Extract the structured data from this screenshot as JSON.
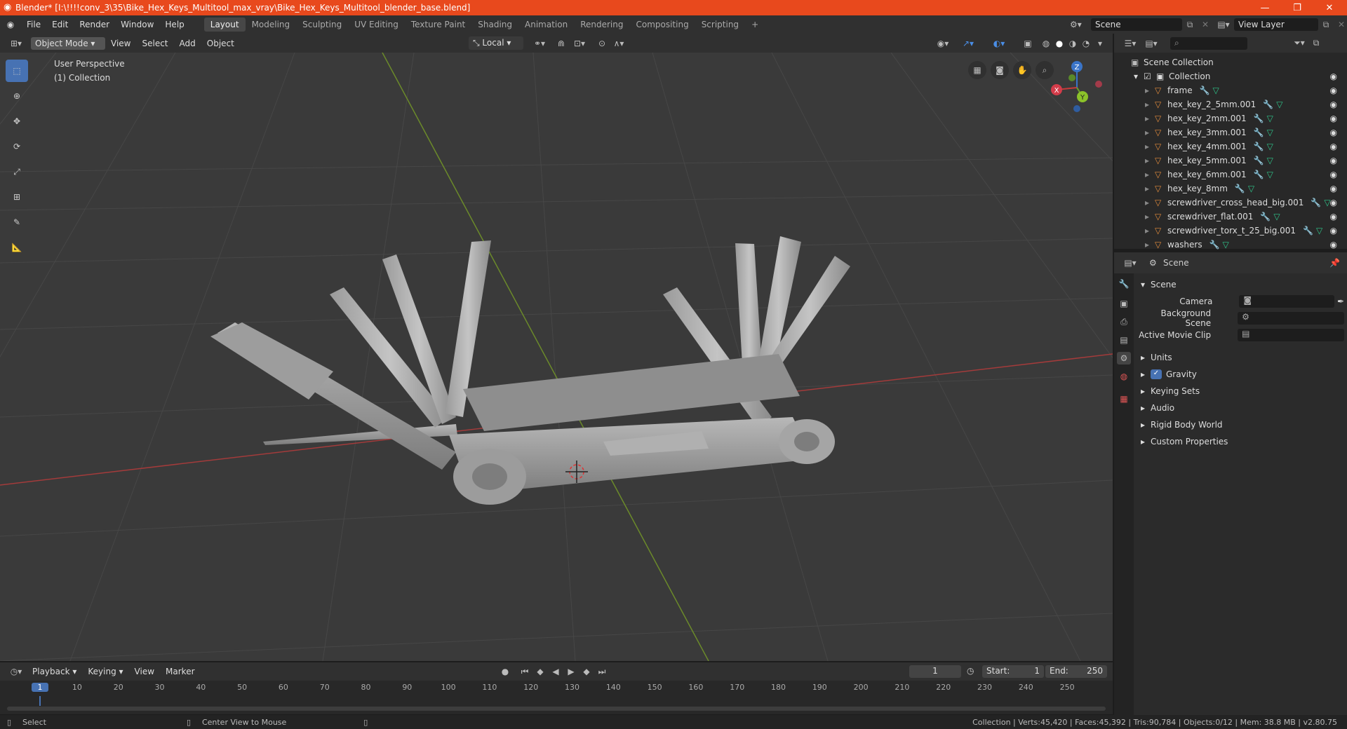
{
  "window": {
    "title": "Blender* [I:\\!!!!conv_3\\35\\Bike_Hex_Keys_Multitool_max_vray\\Bike_Hex_Keys_Multitool_blender_base.blend]",
    "minimize": "—",
    "maximize": "❐",
    "close": "✕"
  },
  "menu": [
    "File",
    "Edit",
    "Render",
    "Window",
    "Help"
  ],
  "workspaces": [
    "Layout",
    "Modeling",
    "Sculpting",
    "UV Editing",
    "Texture Paint",
    "Shading",
    "Animation",
    "Rendering",
    "Compositing",
    "Scripting"
  ],
  "active_workspace": "Layout",
  "scene_name": "Scene",
  "view_layer": "View Layer",
  "viewport_header": {
    "mode": "Object Mode",
    "menus": [
      "View",
      "Select",
      "Add",
      "Object"
    ],
    "transform_orientation": "Local"
  },
  "viewport": {
    "perspective_label": "User Perspective",
    "collection_label": "(1) Collection",
    "gizmo": {
      "x": "X",
      "y": "Y",
      "z": "Z"
    }
  },
  "outliner": {
    "root": "Scene Collection",
    "collection": "Collection",
    "items": [
      {
        "name": "frame"
      },
      {
        "name": "hex_key_2_5mm.001"
      },
      {
        "name": "hex_key_2mm.001"
      },
      {
        "name": "hex_key_3mm.001"
      },
      {
        "name": "hex_key_4mm.001"
      },
      {
        "name": "hex_key_5mm.001"
      },
      {
        "name": "hex_key_6mm.001"
      },
      {
        "name": "hex_key_8mm"
      },
      {
        "name": "screwdriver_cross_head_big.001"
      },
      {
        "name": "screwdriver_flat.001"
      },
      {
        "name": "screwdriver_torx_t_25_big.001"
      },
      {
        "name": "washers"
      }
    ]
  },
  "properties": {
    "header": "Scene",
    "section": "Scene",
    "fields": [
      {
        "label": "Camera"
      },
      {
        "label": "Background Scene"
      },
      {
        "label": "Active Movie Clip"
      }
    ],
    "panels": [
      "Units",
      "Gravity",
      "Keying Sets",
      "Audio",
      "Rigid Body World",
      "Custom Properties"
    ]
  },
  "timeline": {
    "menus": [
      "Playback",
      "Keying",
      "View",
      "Marker"
    ],
    "current_frame": "1",
    "start_label": "Start:",
    "start": "1",
    "end_label": "End:",
    "end": "250",
    "ticks": [
      "1",
      "10",
      "20",
      "30",
      "40",
      "50",
      "60",
      "70",
      "80",
      "90",
      "100",
      "110",
      "120",
      "130",
      "140",
      "150",
      "160",
      "170",
      "180",
      "190",
      "200",
      "210",
      "220",
      "230",
      "240",
      "250"
    ]
  },
  "status": {
    "left1": "Select",
    "left2": "Center View to Mouse",
    "right": "Collection | Verts:45,420 | Faces:45,392 | Tris:90,784 | Objects:0/12 | Mem: 38.8 MB | v2.80.75"
  }
}
